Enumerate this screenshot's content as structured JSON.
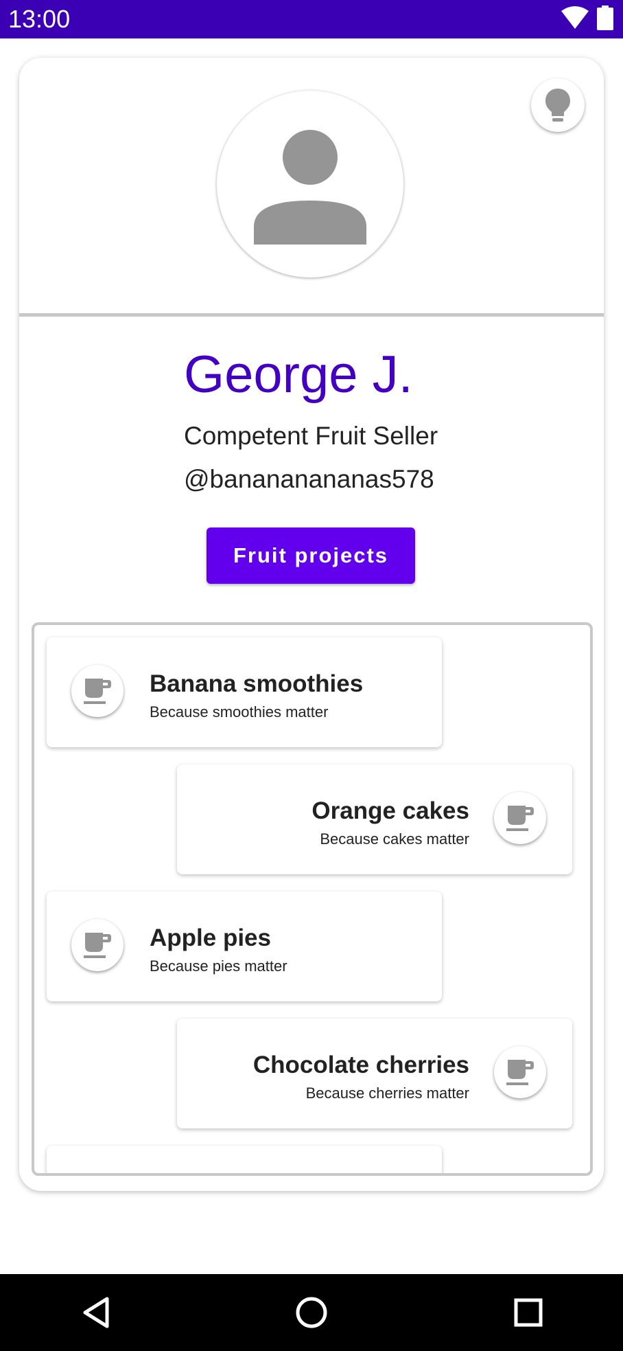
{
  "status_bar": {
    "time": "13:00",
    "icons": [
      "wifi-icon",
      "battery-icon"
    ],
    "background": "#3b00b3"
  },
  "profile": {
    "avatar_icon": "person-icon",
    "hint_icon": "lightbulb-icon",
    "name": "George J.",
    "title": "Competent Fruit Seller",
    "handle": "@banananananas578",
    "name_color": "#4400c2"
  },
  "projects_button": {
    "label": "Fruit projects",
    "color": "#6200ee"
  },
  "projects": [
    {
      "title": "Banana smoothies",
      "subtitle": "Because smoothies matter",
      "icon": "cup-icon",
      "align": "left"
    },
    {
      "title": "Orange cakes",
      "subtitle": "Because cakes matter",
      "icon": "cup-icon",
      "align": "right"
    },
    {
      "title": "Apple pies",
      "subtitle": "Because pies matter",
      "icon": "cup-icon",
      "align": "left"
    },
    {
      "title": "Chocolate cherries",
      "subtitle": "Because cherries matter",
      "icon": "cup-icon",
      "align": "right"
    }
  ],
  "nav_bar": {
    "buttons": [
      "back-icon",
      "home-icon",
      "recents-icon"
    ]
  }
}
